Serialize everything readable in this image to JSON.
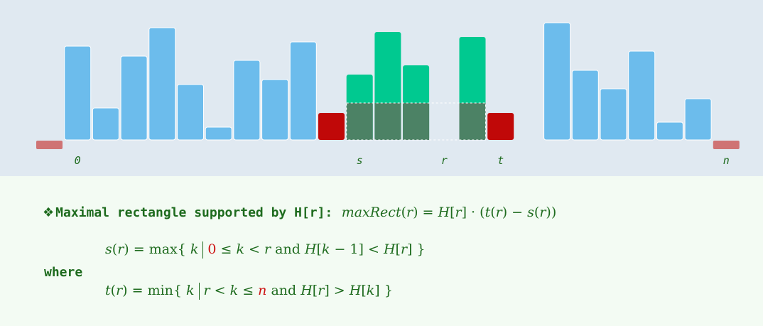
{
  "diagram": {
    "bar_heights": [
      0,
      132,
      45,
      118,
      158,
      78,
      18,
      112,
      85,
      138,
      38,
      92,
      152,
      105,
      0,
      145,
      38,
      0,
      165,
      98,
      72,
      125,
      25,
      58,
      0
    ],
    "subsumed_heights": [
      0,
      0,
      0,
      0,
      0,
      0,
      0,
      0,
      0,
      0,
      0,
      0,
      0,
      0,
      0,
      0,
      0,
      0,
      0,
      0,
      0,
      0,
      0,
      0,
      0
    ],
    "rect_height": 52,
    "bar_kinds": [
      "sentinel",
      "blue",
      "blue",
      "blue",
      "blue",
      "blue",
      "blue",
      "blue",
      "blue",
      "blue",
      "red",
      "green",
      "green",
      "green",
      "dark",
      "green",
      "red",
      "blue",
      "blue",
      "blue",
      "blue",
      "blue",
      "blue",
      "blue",
      "sentinel"
    ],
    "labels": {
      "zero": "0",
      "s": "s",
      "r": "r",
      "t": "t",
      "n": "n"
    },
    "colors": {
      "blue": "#6cbcec",
      "red": "#c00808",
      "green": "#00c990",
      "dark": "#1b6b14",
      "rect": "#4c8265",
      "sentinel": "#cf7374",
      "background": "#e0e9f1"
    }
  },
  "text": {
    "heading_label": "Maximal rectangle supported by H[r]:",
    "heading_formula_lhs": "maxRect",
    "where": "where"
  }
}
